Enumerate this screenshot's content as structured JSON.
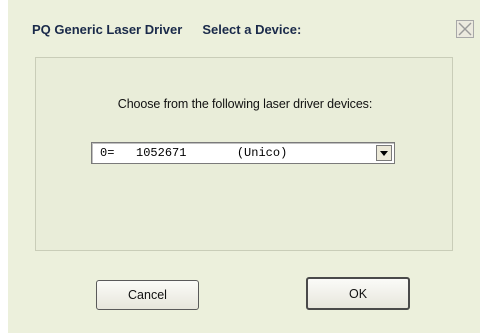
{
  "window": {
    "title_app": "PQ Generic Laser Driver",
    "title_action": "Select a Device:"
  },
  "group": {
    "prompt": "Choose from the following laser driver devices:"
  },
  "device_select": {
    "selected_index": "0=",
    "selected_serial": "1052671",
    "selected_name": "(Unico)"
  },
  "buttons": {
    "cancel_label": "Cancel",
    "ok_label": "OK"
  },
  "icons": {
    "close": "close-icon",
    "dropdown": "chevron-down-icon"
  },
  "colors": {
    "dialog_background": "#ecf0dc",
    "title_text": "#1a2a4a"
  }
}
